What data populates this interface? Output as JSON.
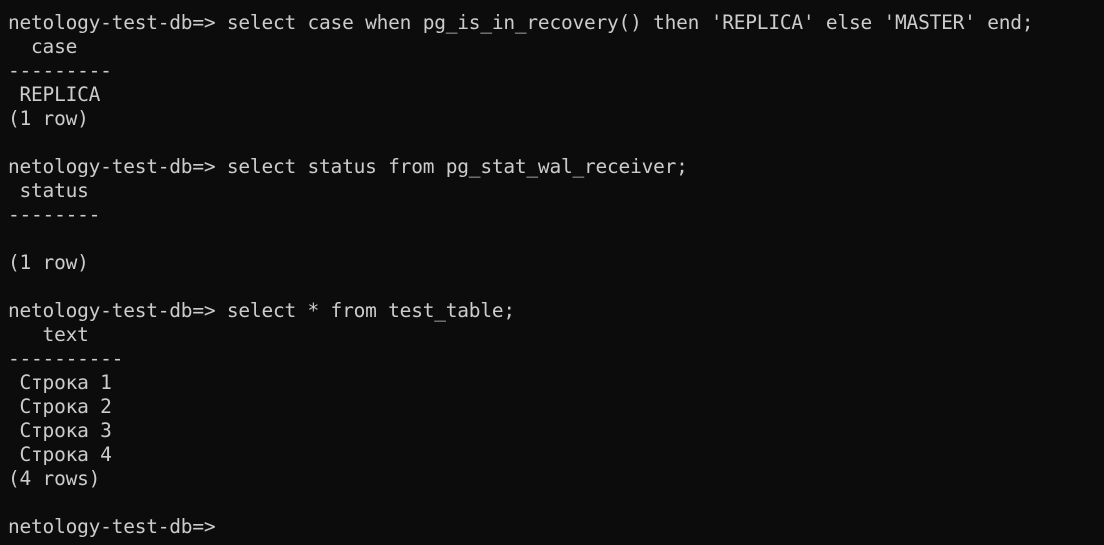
{
  "terminal": {
    "lines": [
      "netology-test-db=> select case when pg_is_in_recovery() then 'REPLICA' else 'MASTER' end;",
      "  case",
      "---------",
      " REPLICA",
      "(1 row)",
      "",
      "netology-test-db=> select status from pg_stat_wal_receiver;",
      " status",
      "--------",
      "",
      "(1 row)",
      "",
      "netology-test-db=> select * from test_table;",
      "   text",
      "----------",
      " Строка 1",
      " Строка 2",
      " Строка 3",
      " Строка 4",
      "(4 rows)",
      "",
      "netology-test-db=> "
    ]
  }
}
